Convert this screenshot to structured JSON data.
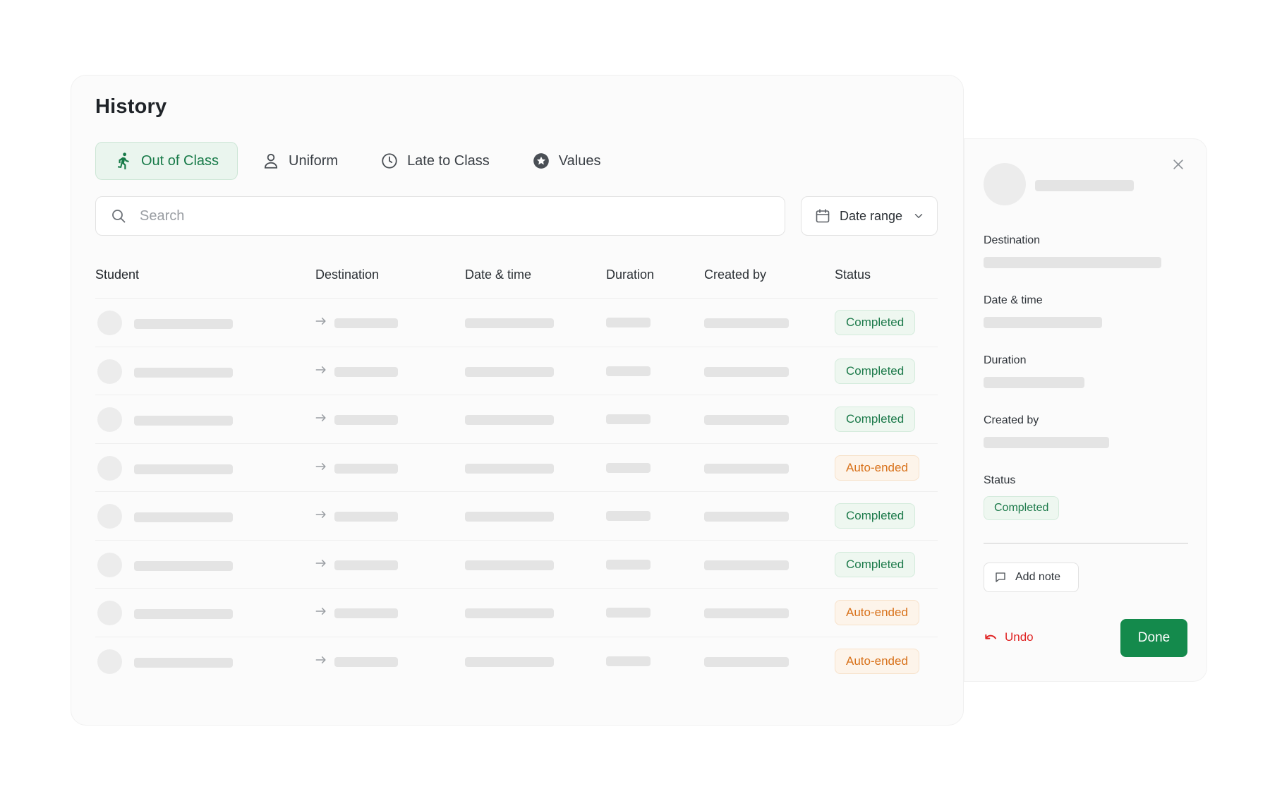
{
  "title": "History",
  "tabs": [
    {
      "label": "Out of Class",
      "icon": "walking-person-icon",
      "active": true
    },
    {
      "label": "Uniform",
      "icon": "person-icon",
      "active": false
    },
    {
      "label": "Late to Class",
      "icon": "clock-icon",
      "active": false
    },
    {
      "label": "Values",
      "icon": "star-badge-icon",
      "active": false
    }
  ],
  "search": {
    "placeholder": "Search"
  },
  "date_range": {
    "label": "Date range"
  },
  "table": {
    "headers": {
      "student": "Student",
      "destination": "Destination",
      "datetime": "Date & time",
      "duration": "Duration",
      "created_by": "Created by",
      "status": "Status"
    },
    "rows": [
      {
        "status": "Completed"
      },
      {
        "status": "Completed"
      },
      {
        "status": "Completed"
      },
      {
        "status": "Auto-ended"
      },
      {
        "status": "Completed"
      },
      {
        "status": "Completed"
      },
      {
        "status": "Auto-ended"
      },
      {
        "status": "Auto-ended"
      }
    ]
  },
  "panel": {
    "destination_label": "Destination",
    "datetime_label": "Date & time",
    "duration_label": "Duration",
    "created_by_label": "Created by",
    "status_label": "Status",
    "status_value": "Completed",
    "add_note_label": "Add note",
    "undo_label": "Undo",
    "done_label": "Done"
  },
  "colors": {
    "accent": "#148a4c",
    "completed_text": "#1c7a4a",
    "auto_ended_text": "#d8711a",
    "undo": "#e02424"
  }
}
